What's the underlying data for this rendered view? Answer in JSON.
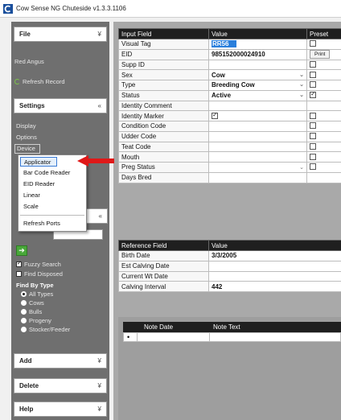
{
  "window": {
    "title": "Cow Sense NG Chuteside v1.3.3.1106"
  },
  "sidebar": {
    "file_label": "File",
    "breed": "Red Angus",
    "refresh_record": "Refresh Record",
    "settings_label": "Settings",
    "settings_items": [
      "Display",
      "Options",
      "Device"
    ],
    "search_placeholder": "Visual Tag",
    "fuzzy_search": "Fuzzy Search",
    "find_disposed": "Find Disposed",
    "find_by_type": "Find By Type",
    "type_options": [
      "All Types",
      "Cows",
      "Bulls",
      "Progeny",
      "Stocker/Feeder"
    ],
    "add_label": "Add",
    "delete_label": "Delete",
    "help_label": "Help"
  },
  "device_menu": {
    "items": [
      "Applicator",
      "Bar Code Reader",
      "EID Reader",
      "Linear",
      "Scale"
    ],
    "refresh_ports": "Refresh Ports"
  },
  "input_grid": {
    "headers": [
      "Input Field",
      "Value",
      "Preset"
    ],
    "rows": [
      {
        "field": "Visual Tag",
        "value": "RR56",
        "preset": false
      },
      {
        "field": "EID",
        "value": "985152000024910",
        "button": "Print"
      },
      {
        "field": "Supp ID",
        "value": "",
        "preset": false
      },
      {
        "field": "Sex",
        "value": "Cow",
        "preset": false
      },
      {
        "field": "Type",
        "value": "Breeding Cow",
        "preset": false
      },
      {
        "field": "Status",
        "value": "Active",
        "preset": true
      },
      {
        "field": "Identity Comment",
        "value": ""
      },
      {
        "field": "Identity Marker",
        "value": "",
        "preset": false
      },
      {
        "field": "Condition Code",
        "value": "",
        "preset": false
      },
      {
        "field": "Udder Code",
        "value": "",
        "preset": false
      },
      {
        "field": "Teat Code",
        "value": "",
        "preset": false
      },
      {
        "field": "Mouth",
        "value": "",
        "preset": false
      },
      {
        "field": "Preg Status",
        "value": "",
        "preset": false
      },
      {
        "field": "Days Bred",
        "value": ""
      }
    ]
  },
  "reference_grid": {
    "headers": [
      "Reference Field",
      "Value"
    ],
    "rows": [
      {
        "field": "Birth Date",
        "value": "3/3/2005"
      },
      {
        "field": "Est Calving Date",
        "value": ""
      },
      {
        "field": "Current Wt Date",
        "value": ""
      },
      {
        "field": "Calving Interval",
        "value": "442"
      }
    ]
  },
  "notes_grid": {
    "headers": [
      "Note Date",
      "Note Text"
    ],
    "new_row_marker": "•"
  },
  "colors": {
    "sidebar_bg": "#6f6f6f",
    "grid_header": "#1f1f1f",
    "selected_cell": "#2a7fdc",
    "arrow": "#e01818",
    "go_button": "#49a83a"
  }
}
